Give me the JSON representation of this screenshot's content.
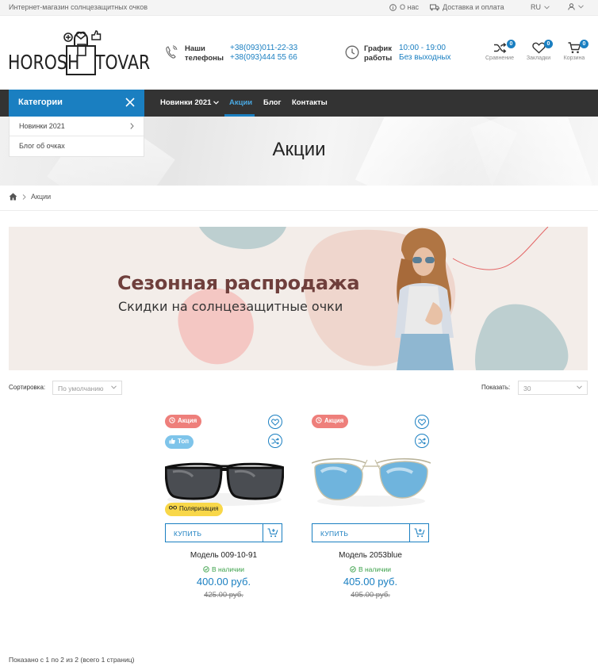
{
  "topbar": {
    "tagline": "Интернет-магазин солнцезащитных очков",
    "about": "О нас",
    "delivery": "Доставка и оплата",
    "lang": "RU"
  },
  "header": {
    "logo_left": "HOROSH",
    "logo_right": "TOVAR",
    "phones_label_1": "Наши",
    "phones_label_2": "телефоны",
    "phone_1": "+38(093)011-22-33",
    "phone_2": "+38(093)444 55 66",
    "schedule_label_1": "График",
    "schedule_label_2": "работы",
    "schedule_hours": "10:00 - 19:00",
    "schedule_days": "Без выходных",
    "compare_label": "Сравнение",
    "compare_count": "0",
    "wishlist_label": "Закладки",
    "wishlist_count": "0",
    "cart_label": "Корзина",
    "cart_count": "0"
  },
  "nav": {
    "categories_label": "Категории",
    "items": [
      {
        "label": "Новинки 2021"
      },
      {
        "label": "Акции"
      },
      {
        "label": "Блог"
      },
      {
        "label": "Контакты"
      }
    ],
    "dropdown": [
      {
        "label": "Новинки 2021"
      },
      {
        "label": "Блог об очках"
      }
    ]
  },
  "page": {
    "title": "Акции",
    "breadcrumb_current": "Акции"
  },
  "banner": {
    "title": "Сезонная распродажа",
    "subtitle": "Скидки на солнцезащитные очки"
  },
  "toolbar": {
    "sort_label": "Сортировка:",
    "sort_value": "По умолчанию",
    "show_label": "Показать:",
    "show_value": "30"
  },
  "products": [
    {
      "name": "Модель 009-10-91",
      "stock": "В наличии",
      "price": "400.00 руб.",
      "old_price": "425.00 руб.",
      "tag_sale": "Акция",
      "tag_top": "Топ",
      "tag_pol": "Поляризация",
      "buy_label": "КУПИТЬ"
    },
    {
      "name": "Модель 2053blue",
      "stock": "В наличии",
      "price": "405.00 руб.",
      "old_price": "495.00 руб.",
      "tag_sale": "Акция",
      "buy_label": "КУПИТЬ"
    }
  ],
  "footer_info": "Показано с 1 по 2 из 2 (всего 1 страниц)",
  "colors": {
    "accent": "#1a7fc1",
    "nav_bg": "#333333",
    "sale_tag": "#ee7f7b",
    "top_tag": "#7ec4ea",
    "polar_tag": "#f8d749",
    "banner_title": "#6f3f3c"
  }
}
